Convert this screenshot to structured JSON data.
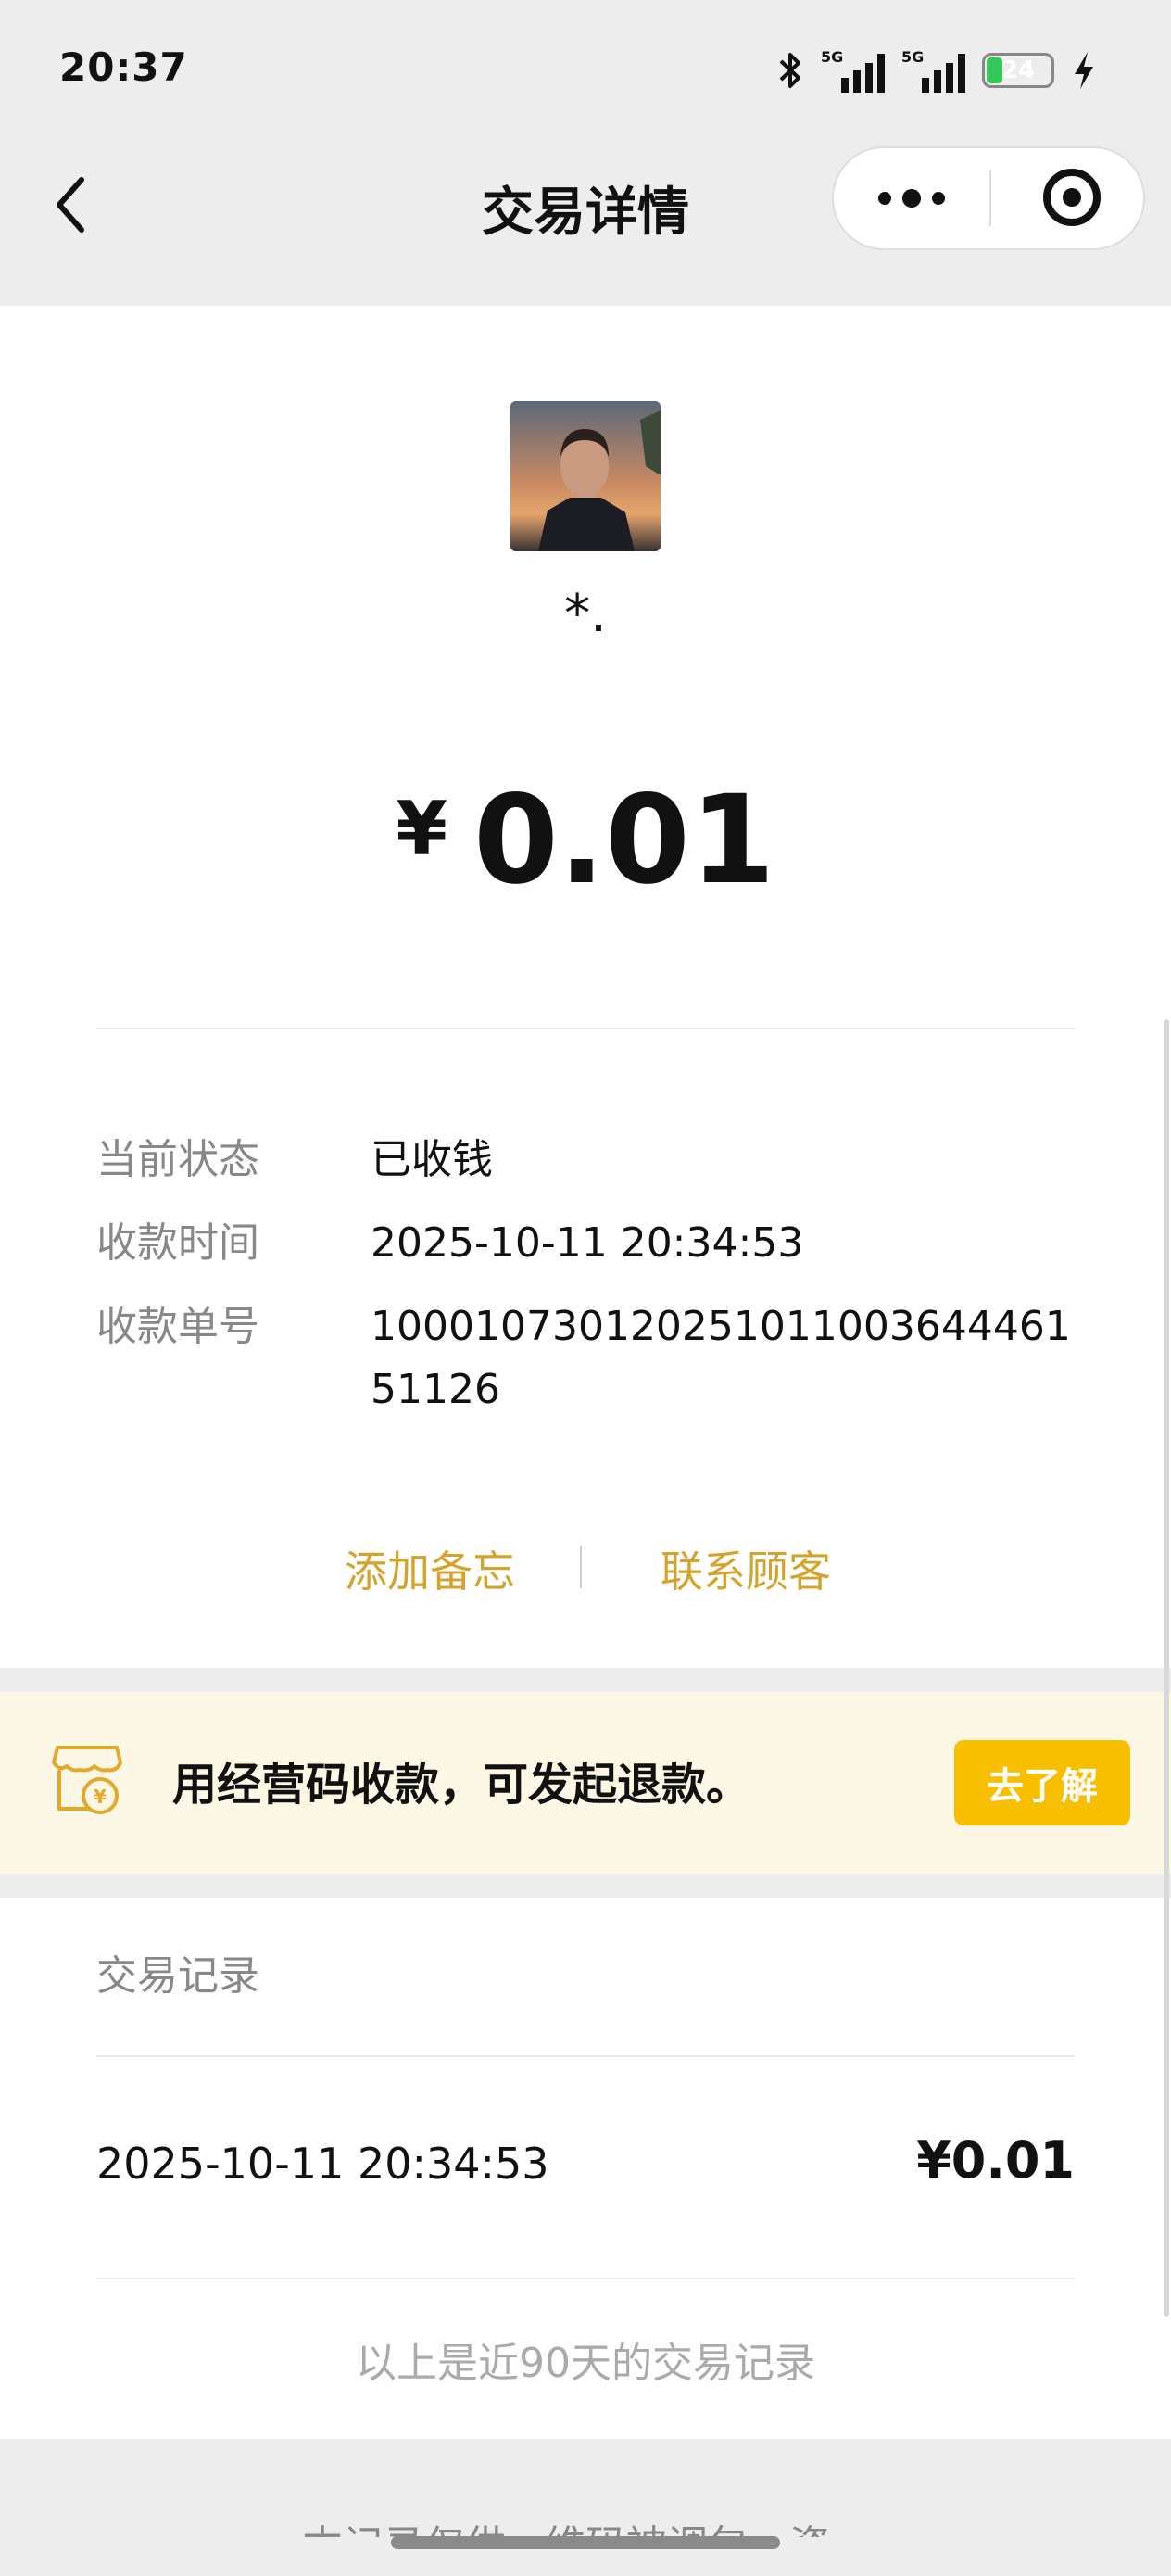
{
  "status_bar": {
    "time": "20:37",
    "network_1": "5G",
    "network_2": "5G",
    "battery": "24",
    "battery_level": 0.24,
    "icons": [
      "bluetooth-icon",
      "signal-icon",
      "signal-icon",
      "battery-icon",
      "charging-icon"
    ]
  },
  "nav": {
    "title": "交易详情",
    "back_icon": "chevron-left-icon",
    "more_icon": "more-dots-icon",
    "close_icon": "target-circle-icon"
  },
  "payer": {
    "nickname": "*."
  },
  "amount": {
    "currency": "¥",
    "value": "0.01"
  },
  "details": [
    {
      "label": "当前状态",
      "value": "已收钱"
    },
    {
      "label": "收款时间",
      "value": "2025-10-11 20:34:53"
    },
    {
      "label": "收款单号",
      "value": "10001073012025101100364446151126"
    }
  ],
  "actions": {
    "add_note": "添加备忘",
    "contact_customer": "联系顾客",
    "color": "#d4a32c"
  },
  "promo": {
    "text": "用经营码收款，可发起退款。",
    "button": "去了解",
    "button_color": "#f8be00",
    "icon": "shop-yuan-icon"
  },
  "records": {
    "title": "交易记录",
    "items": [
      {
        "time": "2025-10-11 20:34:53",
        "amount": "¥0.01"
      }
    ],
    "footer": "以上是近90天的交易记录"
  },
  "bottom_partial_text": "本记录仅供...维码被调包，资..."
}
